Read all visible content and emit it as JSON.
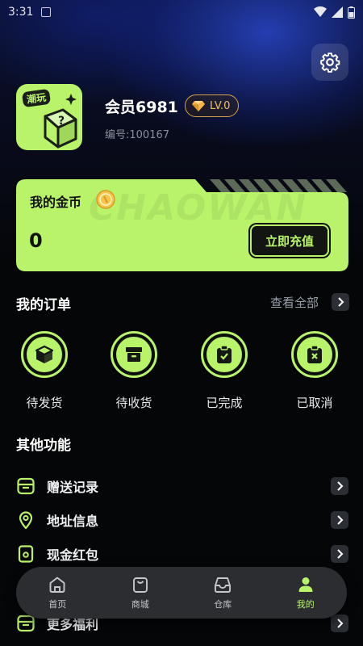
{
  "status_bar": {
    "time": "3:31"
  },
  "profile": {
    "username": "会员6981",
    "level": "LV.0",
    "user_id": "编号:100167",
    "avatar_tag": "潮玩"
  },
  "coin_card": {
    "title": "我的金币",
    "balance": "0",
    "recharge_label": "立即充值",
    "watermark": "CHAOWAN"
  },
  "orders": {
    "title": "我的订单",
    "view_all": "查看全部",
    "items": [
      {
        "label": "待发货",
        "icon": "package-icon"
      },
      {
        "label": "待收货",
        "icon": "box-receive-icon"
      },
      {
        "label": "已完成",
        "icon": "clipboard-check-icon"
      },
      {
        "label": "已取消",
        "icon": "clipboard-x-icon"
      }
    ]
  },
  "functions": {
    "title": "其他功能",
    "items": [
      {
        "label": "赠送记录",
        "icon": "gift-record-icon"
      },
      {
        "label": "地址信息",
        "icon": "location-pin-icon"
      },
      {
        "label": "现金红包",
        "icon": "red-packet-icon"
      },
      {
        "label": "更多福利",
        "icon": "more-benefits-icon"
      }
    ]
  },
  "tabbar": {
    "items": [
      {
        "label": "首页",
        "icon": "home-icon",
        "active": false
      },
      {
        "label": "商城",
        "icon": "shopping-bag-icon",
        "active": false
      },
      {
        "label": "仓库",
        "icon": "warehouse-icon",
        "active": false
      },
      {
        "label": "我的",
        "icon": "profile-icon",
        "active": true
      }
    ]
  },
  "colors": {
    "accent": "#b8f36a",
    "background": "#050608",
    "gold": "#d4a24a"
  }
}
